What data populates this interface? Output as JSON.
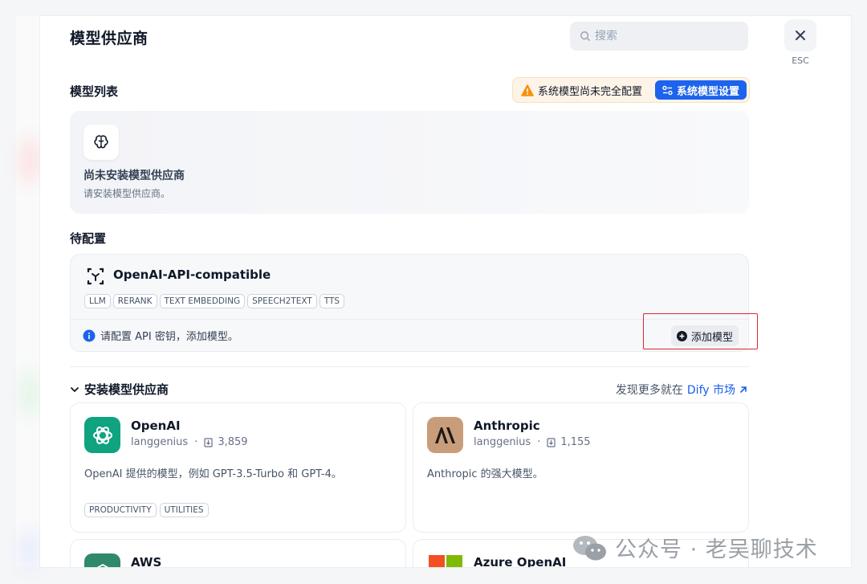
{
  "header": {
    "title": "模型供应商",
    "search_placeholder": "搜索",
    "esc_label": "ESC"
  },
  "model_list": {
    "heading": "模型列表",
    "warning_text": "系统模型尚未完全配置",
    "system_settings_label": "系统模型设置",
    "empty_title": "尚未安装模型供应商",
    "empty_desc": "请安装模型供应商。"
  },
  "pending": {
    "heading": "待配置",
    "provider_name": "OpenAI-API-compatible",
    "tags": [
      "LLM",
      "RERANK",
      "TEXT EMBEDDING",
      "SPEECH2TEXT",
      "TTS"
    ],
    "info_text": "请配置 API 密钥，添加模型。",
    "add_model_label": "添加模型"
  },
  "install": {
    "heading": "安装模型供应商",
    "discover_prefix": "发现更多就在",
    "discover_link": "Dify 市场",
    "providers": [
      {
        "name": "OpenAI",
        "author": "langgenius",
        "installs": "3,859",
        "desc": "OpenAI 提供的模型，例如 GPT-3.5-Turbo 和 GPT-4。",
        "tags": [
          "PRODUCTIVITY",
          "UTILITIES"
        ],
        "logo_color": "#10a37f",
        "icon": "openai-logo-icon"
      },
      {
        "name": "Anthropic",
        "author": "langgenius",
        "installs": "1,155",
        "desc": "Anthropic 的强大模型。",
        "tags": [],
        "logo_color": "#c99d7a",
        "icon": "anthropic-logo-icon"
      },
      {
        "name": "AWS",
        "logo_color": "#2e8a6a",
        "icon": "aws-logo-icon"
      },
      {
        "name": "Azure OpenAI",
        "icon": "microsoft-logo-icon"
      }
    ]
  },
  "watermark": {
    "text": "公众号 · 老吴聊技术"
  },
  "colors": {
    "accent": "#1d63ed",
    "warning": "#f79009",
    "highlight_box": "#e0262f"
  }
}
